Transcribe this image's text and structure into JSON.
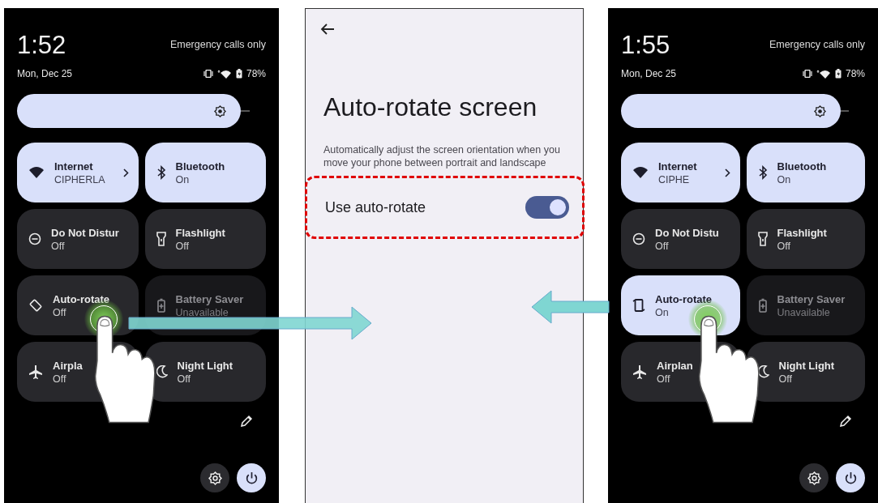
{
  "phones": [
    {
      "time": "1:52",
      "date": "Mon, Dec 25",
      "carrier": "Emergency calls only",
      "battery": "78%",
      "brightness": {
        "level": 0.9
      },
      "tiles": [
        {
          "kind": "internet",
          "title": "Internet",
          "subtitle": "CIPHERLA",
          "on": true,
          "disabled": false,
          "touched": false
        },
        {
          "kind": "bluetooth",
          "title": "Bluetooth",
          "subtitle": "On",
          "on": true,
          "disabled": false,
          "touched": false
        },
        {
          "kind": "dnd",
          "title": "Do Not Distur",
          "subtitle": "Off",
          "on": false,
          "disabled": false,
          "touched": false
        },
        {
          "kind": "flashlight",
          "title": "Flashlight",
          "subtitle": "Off",
          "on": false,
          "disabled": false,
          "touched": false
        },
        {
          "kind": "rotate",
          "title": "Auto-rotate",
          "subtitle": "Off",
          "on": false,
          "disabled": false,
          "touched": true
        },
        {
          "kind": "battery",
          "title": "Battery Saver",
          "subtitle": "Unavailable",
          "on": false,
          "disabled": true,
          "touched": false
        },
        {
          "kind": "airplane",
          "title": "Airpla",
          "subtitle": "Off",
          "on": false,
          "disabled": false,
          "touched": false
        },
        {
          "kind": "night",
          "title": "Night Light",
          "subtitle": "Off",
          "on": false,
          "disabled": false,
          "touched": false
        }
      ]
    },
    {
      "time": "1:55",
      "date": "Mon, Dec 25",
      "carrier": "Emergency calls only",
      "battery": "78%",
      "brightness": {
        "level": 0.9
      },
      "tiles": [
        {
          "kind": "internet",
          "title": "Internet",
          "subtitle": "CIPHE",
          "on": true,
          "disabled": false,
          "touched": false
        },
        {
          "kind": "bluetooth",
          "title": "Bluetooth",
          "subtitle": "On",
          "on": true,
          "disabled": false,
          "touched": false
        },
        {
          "kind": "dnd",
          "title": "Do Not Distu",
          "subtitle": "Off",
          "on": false,
          "disabled": false,
          "touched": false
        },
        {
          "kind": "flashlight",
          "title": "Flashlight",
          "subtitle": "Off",
          "on": false,
          "disabled": false,
          "touched": false
        },
        {
          "kind": "rotate",
          "title": "Auto-rotate",
          "subtitle": "On",
          "on": true,
          "disabled": false,
          "touched": true
        },
        {
          "kind": "battery",
          "title": "Battery Saver",
          "subtitle": "Unavailable",
          "on": false,
          "disabled": true,
          "touched": false
        },
        {
          "kind": "airplane",
          "title": "Airplan",
          "subtitle": "Off",
          "on": false,
          "disabled": false,
          "touched": false
        },
        {
          "kind": "night",
          "title": "Night Light",
          "subtitle": "Off",
          "on": false,
          "disabled": false,
          "touched": false
        }
      ]
    }
  ],
  "settings_screen": {
    "title": "Auto-rotate screen",
    "description": "Automatically adjust the screen orientation when you move your phone between portrait and landscape",
    "option": {
      "label": "Use auto-rotate",
      "on": true,
      "highlighted": true
    }
  }
}
